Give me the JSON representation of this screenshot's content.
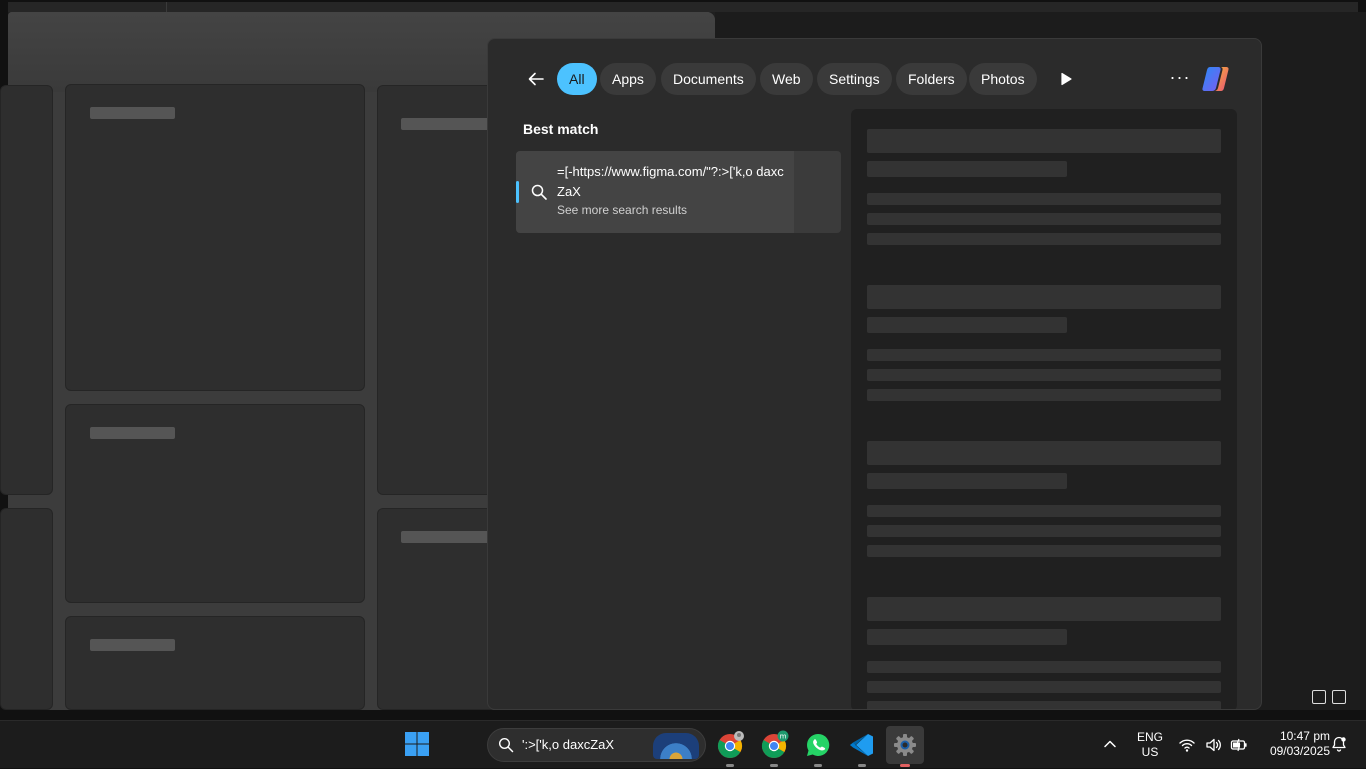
{
  "flyout": {
    "filters": [
      "All",
      "Apps",
      "Documents",
      "Web",
      "Settings",
      "Folders",
      "Photos"
    ],
    "active_filter": "All",
    "more_label": "···",
    "section_title": "Best match",
    "best_match": {
      "query": "=[-https://www.figma.com/\"?:>['k,o daxcZaX",
      "subtitle": "See more search results"
    }
  },
  "taskbar": {
    "search_text": "':>['k,o daxcZaX",
    "apps": [
      "chrome-profile-1",
      "chrome-profile-m",
      "whatsapp",
      "vscode",
      "settings"
    ],
    "active_app": "settings",
    "language": {
      "line1": "ENG",
      "line2": "US"
    },
    "time": "10:47 pm",
    "date": "09/03/2025"
  },
  "colors": {
    "accent": "#4cc2ff",
    "flyout_bg": "#2b2b2b",
    "taskbar_bg": "#1c1c1c"
  }
}
